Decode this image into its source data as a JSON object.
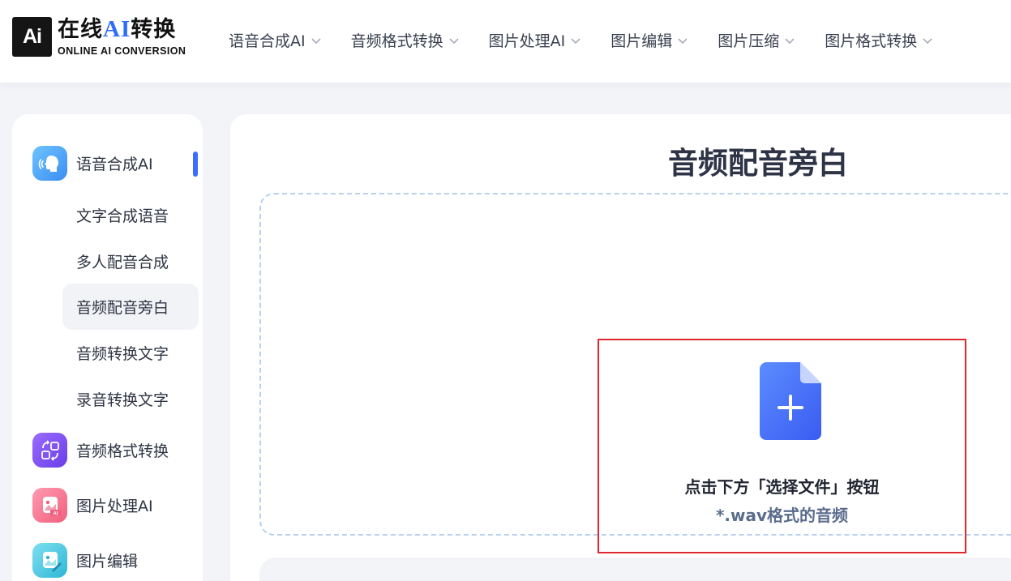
{
  "logo": {
    "mark": "Ai",
    "title_prefix": "在线",
    "title_ai": "AI",
    "title_suffix": "转换",
    "subtitle": "ONLINE AI CONVERSION"
  },
  "nav": {
    "items": [
      {
        "label": "语音合成AI",
        "icon": "chevron-down-icon"
      },
      {
        "label": "音频格式转换",
        "icon": "chevron-down-icon"
      },
      {
        "label": "图片处理AI",
        "icon": "chevron-down-icon"
      },
      {
        "label": "图片编辑",
        "icon": "chevron-down-icon"
      },
      {
        "label": "图片压缩",
        "icon": "chevron-down-icon"
      },
      {
        "label": "图片格式转换",
        "icon": "chevron-down-icon"
      }
    ]
  },
  "sidebar": {
    "categories": [
      {
        "label": "语音合成AI",
        "icon": "speaking-head-icon",
        "active": true
      },
      {
        "label": "音频格式转换",
        "icon": "convert-icon"
      },
      {
        "label": "图片处理AI",
        "icon": "image-ai-icon"
      },
      {
        "label": "图片编辑",
        "icon": "image-edit-icon"
      }
    ],
    "subitems": [
      {
        "label": "文字合成语音"
      },
      {
        "label": "多人配音合成"
      },
      {
        "label": "音频配音旁白",
        "selected": true
      },
      {
        "label": "音频转换文字"
      },
      {
        "label": "录音转换文字"
      }
    ]
  },
  "main": {
    "title": "音频配音旁白",
    "upload_hint": "点击下方「选择文件」按钮",
    "format_hint": "*.wav格式的音频",
    "upload_icon": "file-plus-icon"
  },
  "colors": {
    "accent": "#3b6cff",
    "highlight_border": "#e0262f",
    "dropzone_border": "#b6d2ee"
  }
}
